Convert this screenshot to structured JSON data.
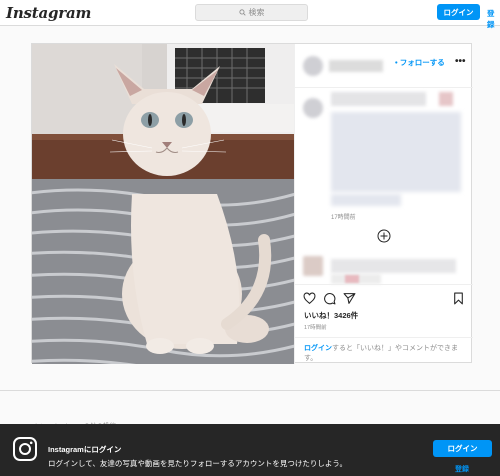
{
  "header": {
    "logo": "Instagram",
    "search_placeholder": "検索",
    "login_label": "ログイン",
    "signup_label": "登録"
  },
  "post": {
    "follow_label": "フォローする",
    "more_label": "•••",
    "caption_time": "17時間前",
    "likes_text": "いいね！3426件",
    "post_time": "17時間前",
    "login_prompt_link": "ログイン",
    "login_prompt_rest": "すると「いいね！」やコメントができます。"
  },
  "more_posts_label": "mint.marine.kanonの他の投稿",
  "banner": {
    "title": "Instagramにログイン",
    "subtitle": "ログインして、友達の写真や動画を見たりフォローするアカウントを見つけたりしよう。",
    "login_label": "ログイン",
    "signup_label": "登録"
  },
  "icons": {
    "search": "search-icon",
    "like": "heart-icon",
    "comment": "comment-icon",
    "share": "share-icon",
    "save": "bookmark-icon",
    "add": "add-circle-icon",
    "banner_logo": "instagram-logo-icon"
  },
  "colors": {
    "accent": "#0095f6",
    "banner_bg": "#262626"
  }
}
